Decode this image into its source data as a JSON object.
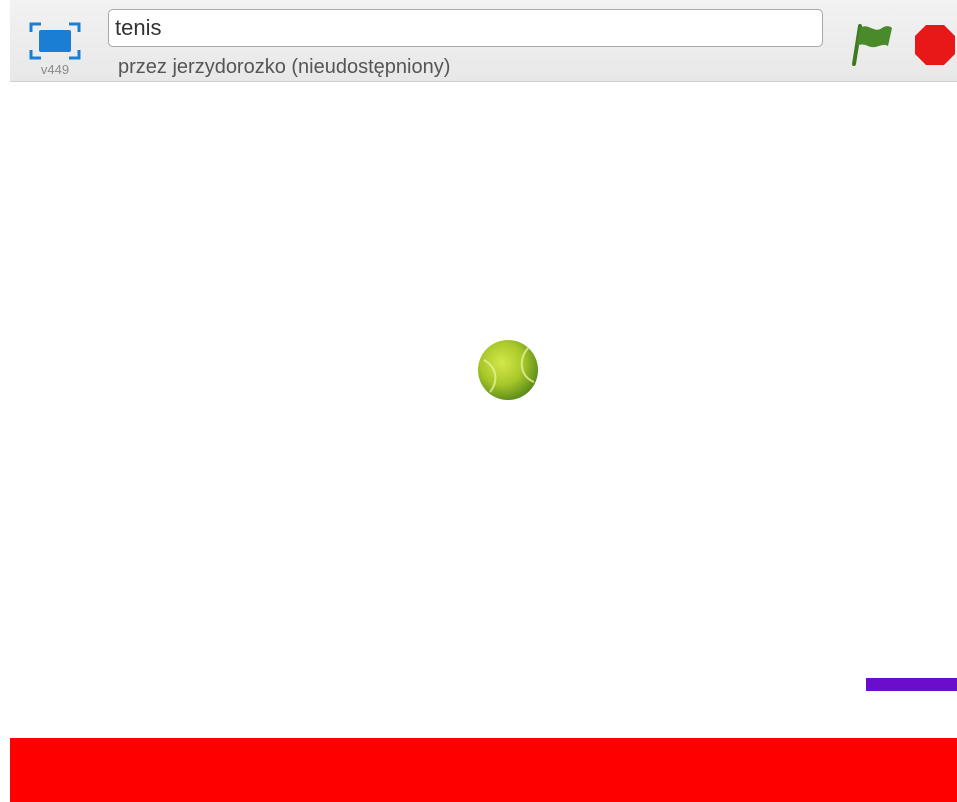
{
  "header": {
    "version": "v449",
    "project_title": "tenis",
    "byline": "przez jerzydorozko (nieudostępniony)"
  },
  "controls": {
    "fullscreen_icon": "fullscreen-icon",
    "green_flag_icon": "green-flag-icon",
    "stop_icon": "stop-sign-icon"
  },
  "stage": {
    "sprites": [
      "tennis-ball",
      "paddle",
      "red-floor"
    ]
  },
  "colors": {
    "accent_blue": "#1a7fd4",
    "flag_green": "#4a8a2a",
    "stop_red": "#e81818",
    "paddle_purple": "#6a0dcc",
    "floor_red": "#ff0000",
    "ball_yellow_green": "#b8d432"
  }
}
